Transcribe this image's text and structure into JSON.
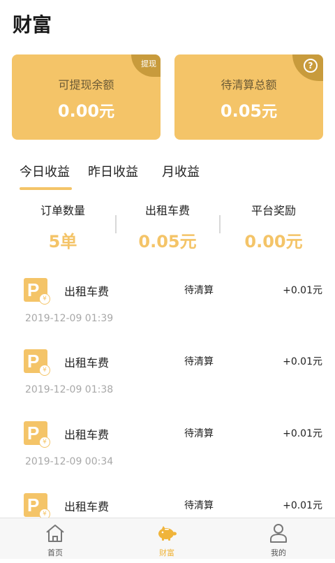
{
  "header": {
    "title": "财富"
  },
  "cards": [
    {
      "label": "可提现余额",
      "amount": "0.00",
      "unit": "元",
      "tag": "提现"
    },
    {
      "label": "待清算总额",
      "amount": "0.05",
      "unit": "元",
      "tag_icon": "question-icon"
    }
  ],
  "tabs": [
    "今日收益",
    "昨日收益",
    "月收益"
  ],
  "active_tab": 0,
  "stats": [
    {
      "label": "订单数量",
      "value": "5单"
    },
    {
      "label": "出租车费",
      "value": "0.05元"
    },
    {
      "label": "平台奖励",
      "value": "0.00元"
    }
  ],
  "records": [
    {
      "title": "出租车费",
      "status": "待清算",
      "amount": "+0.01元",
      "time": "2019-12-09 01:39"
    },
    {
      "title": "出租车费",
      "status": "待清算",
      "amount": "+0.01元",
      "time": "2019-12-09 01:38"
    },
    {
      "title": "出租车费",
      "status": "待清算",
      "amount": "+0.01元",
      "time": "2019-12-09 00:34"
    },
    {
      "title": "出租车费",
      "status": "待清算",
      "amount": "+0.01元",
      "time": ""
    }
  ],
  "record_icon": {
    "letter": "P",
    "badge": "¥"
  },
  "nav": [
    {
      "label": "首页",
      "icon": "home-icon"
    },
    {
      "label": "财富",
      "icon": "piggy-bank-icon"
    },
    {
      "label": "我的",
      "icon": "user-icon"
    }
  ],
  "colors": {
    "accent": "#f4c468",
    "accent_dark": "#c89b3c",
    "nav_active": "#f0b43a"
  }
}
